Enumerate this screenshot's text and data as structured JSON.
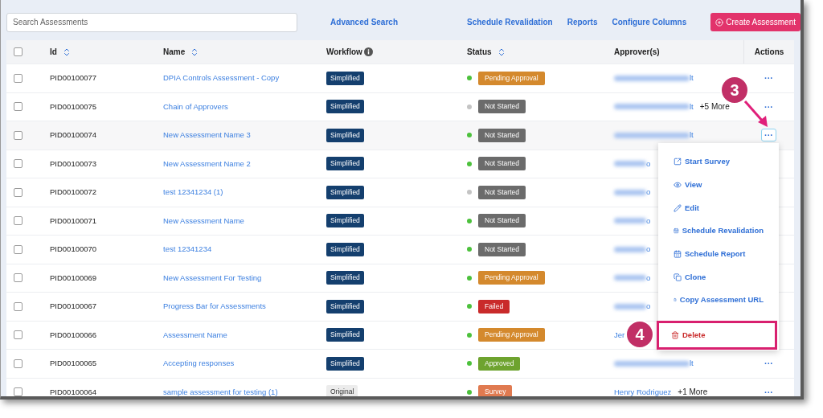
{
  "toolbar": {
    "search": {
      "placeholder": "Search Assessments"
    },
    "links": [
      "Advanced Search",
      "Schedule Revalidation",
      "Reports",
      "Configure Columns"
    ],
    "create_button": "Create Assessment"
  },
  "table": {
    "select_all": {
      "checked": false
    },
    "columns": [
      {
        "label": "Id",
        "kind": "sortable"
      },
      {
        "label": "Name",
        "kind": "sortable"
      },
      {
        "label": "Workflow",
        "kind": "info"
      },
      {
        "label": "Status",
        "kind": "sortable"
      },
      {
        "label": "Approver(s)",
        "kind": "plain"
      },
      {
        "label": "Actions",
        "kind": "actions"
      }
    ],
    "rows": [
      {
        "checked": false,
        "id": "PID00100077",
        "name": "DPIA Controls Assessment - Copy",
        "workflow": {
          "kind": "simplified",
          "label": "Simplified"
        },
        "status": {
          "kind": "pending",
          "label": "Pending Approval",
          "color": "#4cc13c"
        },
        "approver": {
          "blurred": true,
          "tail": "lt"
        },
        "actions": "···",
        "menu_open": false
      },
      {
        "checked": false,
        "id": "PID00100075",
        "name": "Chain of Approvers",
        "workflow": {
          "kind": "simplified",
          "label": "Simplified"
        },
        "status": {
          "kind": "not_started",
          "label": "Not Started",
          "color": "#c4c4c4"
        },
        "approver": {
          "blurred": true,
          "tail": "lt",
          "more": "+5 More"
        },
        "actions": "···",
        "menu_open": false
      },
      {
        "checked": false,
        "id": "PID00100074",
        "name": "New Assessment Name 3",
        "workflow": {
          "kind": "simplified",
          "label": "Simplified"
        },
        "status": {
          "kind": "not_started",
          "label": "Not Started",
          "color": "#4cc13c"
        },
        "approver": {
          "blurred": true,
          "tail": "lt"
        },
        "actions": "···",
        "menu_open": true
      },
      {
        "checked": false,
        "id": "PID00100073",
        "name": "New Assessment Name 2",
        "workflow": {
          "kind": "simplified",
          "label": "Simplified"
        },
        "status": {
          "kind": "not_started",
          "label": "Not Started",
          "color": "#4cc13c"
        },
        "approver": {
          "blurred": true,
          "tail": "o"
        },
        "menu_open": false
      },
      {
        "checked": false,
        "id": "PID00100072",
        "name": "test 12341234 (1)",
        "workflow": {
          "kind": "simplified",
          "label": "Simplified"
        },
        "status": {
          "kind": "not_started",
          "label": "Not Started",
          "color": "#c4c4c4"
        },
        "approver": {
          "blurred": true,
          "tail": "o"
        },
        "menu_open": false
      },
      {
        "checked": false,
        "id": "PID00100071",
        "name": "New Assessment Name",
        "workflow": {
          "kind": "simplified",
          "label": "Simplified"
        },
        "status": {
          "kind": "not_started",
          "label": "Not Started",
          "color": "#4cc13c"
        },
        "approver": {
          "blurred": true,
          "tail": "o"
        },
        "menu_open": false
      },
      {
        "checked": false,
        "id": "PID00100070",
        "name": "test 12341234",
        "workflow": {
          "kind": "simplified",
          "label": "Simplified"
        },
        "status": {
          "kind": "not_started",
          "label": "Not Started",
          "color": "#4cc13c"
        },
        "approver": {
          "blurred": true,
          "tail": "o"
        },
        "menu_open": false
      },
      {
        "checked": false,
        "id": "PID00100069",
        "name": "New Assessment For Testing",
        "workflow": {
          "kind": "simplified",
          "label": "Simplified"
        },
        "status": {
          "kind": "pending",
          "label": "Pending Approval",
          "color": "#4cc13c"
        },
        "approver": {
          "blurred": true,
          "tail": "o"
        },
        "menu_open": false
      },
      {
        "checked": false,
        "id": "PID00100067",
        "name": "Progress Bar for Assessments",
        "workflow": {
          "kind": "simplified",
          "label": "Simplified"
        },
        "status": {
          "kind": "failed",
          "label": "Failed",
          "color": "#4cc13c"
        },
        "approver": {
          "blurred": true,
          "tail": "o"
        },
        "menu_open": false
      },
      {
        "checked": false,
        "id": "PID00100066",
        "name": "Assessment Name",
        "workflow": {
          "kind": "simplified",
          "label": "Simplified"
        },
        "status": {
          "kind": "pending",
          "label": "Pending Approval",
          "color": "#4cc13c"
        },
        "approver": {
          "blurred": false,
          "name": "Jer"
        }
      },
      {
        "checked": false,
        "id": "PID00100065",
        "name": "Accepting responses",
        "workflow": {
          "kind": "simplified",
          "label": "Simplified"
        },
        "status": {
          "kind": "approved",
          "label": "Approved",
          "color": "#4cc13c"
        },
        "approver": {
          "blurred": true,
          "tail": "lt"
        },
        "actions": "···",
        "menu_open": false
      },
      {
        "checked": false,
        "id": "PID00100064",
        "name": "sample assessment for testing (1)",
        "workflow": {
          "kind": "original",
          "label": "Original"
        },
        "status": {
          "kind": "survey",
          "label": "Survey",
          "color": "#4cc13c"
        },
        "approver": {
          "blurred": false,
          "name": "Henry Rodriguez",
          "more": "+1 More"
        },
        "actions": "···",
        "menu_open": false
      }
    ]
  },
  "action_menu": {
    "items": [
      {
        "kind": "external",
        "label": "Start Survey",
        "selected": false
      },
      {
        "kind": "view",
        "label": "View",
        "selected": false
      },
      {
        "kind": "edit",
        "label": "Edit",
        "selected": false
      },
      {
        "kind": "calendar",
        "label": "Schedule Revalidation",
        "selected": false
      },
      {
        "kind": "calendar",
        "label": "Schedule Report",
        "selected": false
      },
      {
        "kind": "clone",
        "label": "Clone",
        "selected": false
      },
      {
        "kind": "copy",
        "label": "Copy Assessment URL",
        "selected": false
      },
      {
        "kind": "delete",
        "label": "Delete",
        "selected": true
      }
    ]
  },
  "callouts": [
    {
      "label": "3",
      "arrow": true
    },
    {
      "label": "4",
      "arrow": false
    }
  ]
}
